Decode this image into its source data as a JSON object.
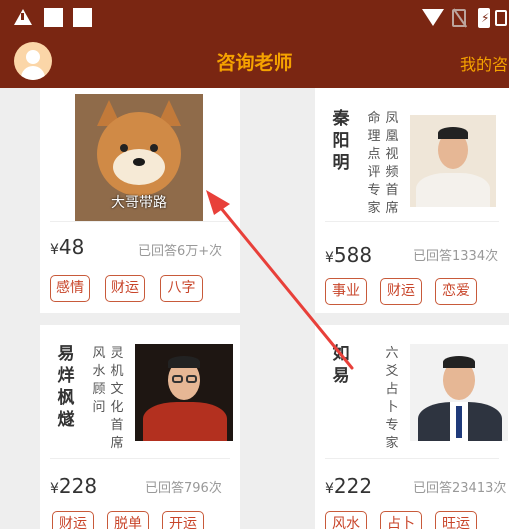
{
  "header": {
    "title": "咨询老师",
    "my_link": "我的咨"
  },
  "cards": [
    {
      "photo_caption": "大哥带路",
      "price_symbol": "¥",
      "price": "48",
      "answered": "已回答6万+次",
      "tags": [
        "感情",
        "财运",
        "八字"
      ]
    },
    {
      "name_chars": [
        "秦",
        "阳",
        "明"
      ],
      "desc_cols": [
        [
          "命",
          "理",
          "点",
          "评",
          "专",
          "家"
        ],
        [
          "凤",
          "凰",
          "视",
          "频",
          "首",
          "席"
        ]
      ],
      "price_symbol": "¥",
      "price": "588",
      "answered": "已回答1334次",
      "tags": [
        "事业",
        "财运",
        "恋爱"
      ]
    },
    {
      "name_chars": [
        "易",
        "烊",
        "枫",
        "燧"
      ],
      "desc_cols": [
        [
          "风",
          "水",
          "顾",
          "问"
        ],
        [
          "灵",
          "机",
          "文",
          "化",
          "首",
          "席"
        ]
      ],
      "price_symbol": "¥",
      "price": "228",
      "answered": "已回答796次",
      "tags": [
        "财运",
        "脱单",
        "开运"
      ]
    },
    {
      "name_chars": [
        "如",
        "易"
      ],
      "desc_cols": [
        [
          "六",
          "爻",
          "占",
          "卜",
          "专",
          "家"
        ]
      ],
      "price_symbol": "¥",
      "price": "222",
      "answered": "已回答23413次",
      "tags": [
        "风水",
        "占卜",
        "旺运"
      ]
    }
  ],
  "colors": {
    "header_bg": "#7a2612",
    "title": "#f5a200",
    "tag": "#c8452a",
    "arrow": "#e8403a"
  }
}
